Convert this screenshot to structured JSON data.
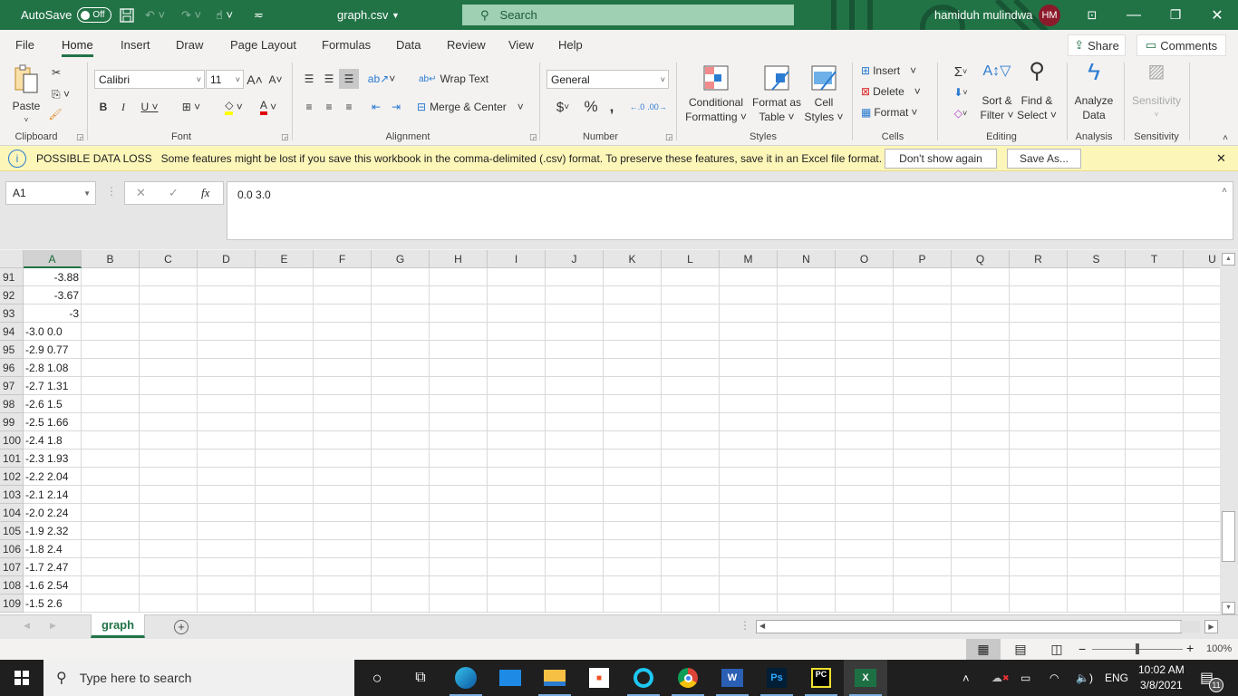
{
  "titlebar": {
    "autosave_label": "AutoSave",
    "autosave_state": "Off",
    "filename": "graph.csv",
    "search_placeholder": "Search",
    "user_name": "hamiduh mulindwa",
    "user_initials": "HM"
  },
  "menu_tabs": [
    "File",
    "Home",
    "Insert",
    "Draw",
    "Page Layout",
    "Formulas",
    "Data",
    "Review",
    "View",
    "Help"
  ],
  "active_tab": "Home",
  "top_buttons": {
    "share": "Share",
    "comments": "Comments"
  },
  "ribbon": {
    "clipboard": {
      "paste": "Paste",
      "label": "Clipboard"
    },
    "font": {
      "name": "Calibri",
      "size": "11",
      "label": "Font",
      "highlight_color": "#ffff00",
      "font_color": "#e00000"
    },
    "alignment": {
      "wrap_text": "Wrap Text",
      "merge_center": "Merge & Center",
      "label": "Alignment"
    },
    "number": {
      "format": "General",
      "label": "Number"
    },
    "styles": {
      "conditional_1": "Conditional",
      "conditional_2": "Formatting",
      "format_table_1": "Format as",
      "format_table_2": "Table",
      "cell_styles_1": "Cell",
      "cell_styles_2": "Styles",
      "label": "Styles"
    },
    "cells": {
      "insert": "Insert",
      "delete": "Delete",
      "format": "Format",
      "label": "Cells"
    },
    "editing": {
      "sort_1": "Sort &",
      "sort_2": "Filter",
      "find_1": "Find &",
      "find_2": "Select",
      "label": "Editing"
    },
    "analysis": {
      "analyze_1": "Analyze",
      "analyze_2": "Data",
      "label": "Analysis"
    },
    "sensitivity": {
      "button": "Sensitivity",
      "label": "Sensitivity"
    }
  },
  "infobar": {
    "title": "POSSIBLE DATA LOSS",
    "message": "Some features might be lost if you save this workbook in the comma-delimited (.csv) format. To preserve these features, save it in an Excel file format.",
    "dont_show": "Don't show again",
    "save_as": "Save As..."
  },
  "formula_bar": {
    "name_box": "A1",
    "formula": "0.0 3.0"
  },
  "columns": [
    "A",
    "B",
    "C",
    "D",
    "E",
    "F",
    "G",
    "H",
    "I",
    "J",
    "K",
    "L",
    "M",
    "N",
    "O",
    "P",
    "Q",
    "R",
    "S",
    "T",
    "U"
  ],
  "rows": [
    {
      "num": "91",
      "a": "-3.88",
      "numeric": true
    },
    {
      "num": "92",
      "a": "-3.67",
      "numeric": true
    },
    {
      "num": "93",
      "a": "-3",
      "numeric": true
    },
    {
      "num": "94",
      "a": "-3.0 0.0",
      "numeric": false
    },
    {
      "num": "95",
      "a": "-2.9 0.77",
      "numeric": false
    },
    {
      "num": "96",
      "a": "-2.8 1.08",
      "numeric": false
    },
    {
      "num": "97",
      "a": "-2.7 1.31",
      "numeric": false
    },
    {
      "num": "98",
      "a": "-2.6 1.5",
      "numeric": false
    },
    {
      "num": "99",
      "a": "-2.5 1.66",
      "numeric": false
    },
    {
      "num": "100",
      "a": "-2.4 1.8",
      "numeric": false
    },
    {
      "num": "101",
      "a": "-2.3 1.93",
      "numeric": false
    },
    {
      "num": "102",
      "a": "-2.2 2.04",
      "numeric": false
    },
    {
      "num": "103",
      "a": "-2.1 2.14",
      "numeric": false
    },
    {
      "num": "104",
      "a": "-2.0 2.24",
      "numeric": false
    },
    {
      "num": "105",
      "a": "-1.9 2.32",
      "numeric": false
    },
    {
      "num": "106",
      "a": "-1.8 2.4",
      "numeric": false
    },
    {
      "num": "107",
      "a": "-1.7 2.47",
      "numeric": false
    },
    {
      "num": "108",
      "a": "-1.6 2.54",
      "numeric": false
    },
    {
      "num": "109",
      "a": "-1.5 2.6",
      "numeric": false
    }
  ],
  "sheets": [
    {
      "name": "graph",
      "active": true
    }
  ],
  "status": {
    "zoom": "100%",
    "zoom_fraction": 0.5
  },
  "taskbar": {
    "search_placeholder": "Type here to search",
    "apps": [
      "cortana",
      "task-view",
      "edge",
      "mail",
      "file-explorer",
      "store",
      "alexa",
      "chrome",
      "word",
      "photoshop",
      "pycharm",
      "excel"
    ],
    "language": "ENG",
    "time": "10:02 AM",
    "date": "3/8/2021",
    "notification_count": "11"
  }
}
